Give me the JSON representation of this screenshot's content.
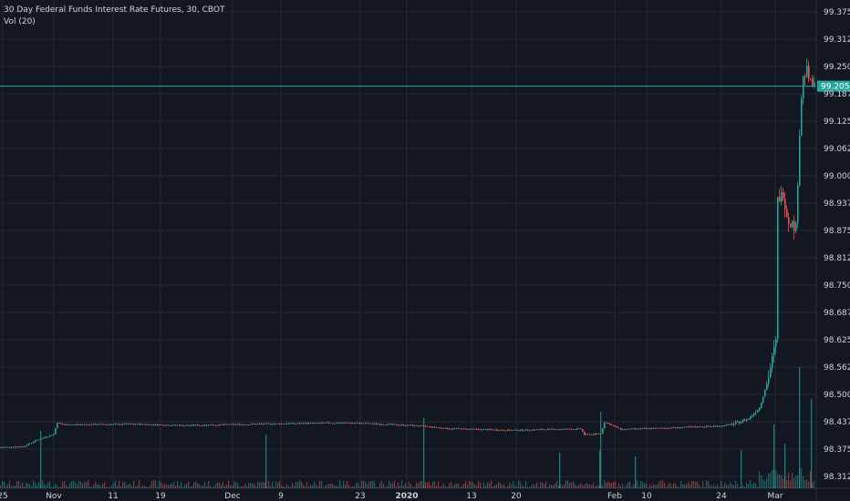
{
  "chart_data": {
    "type": "candlestick",
    "title": "30 Day Federal Funds Interest Rate Futures, 30, CBOT",
    "indicator_label": "Vol (20)",
    "last_price_label": "99.2050",
    "last_price": 99.205,
    "y_ticks": [
      "99.3750",
      "99.3125",
      "99.2500",
      "99.1875",
      "99.1250",
      "99.0625",
      "99.0000",
      "98.9375",
      "98.8750",
      "98.8125",
      "98.7500",
      "98.6875",
      "98.6250",
      "98.5625",
      "98.5000",
      "98.4375",
      "98.3750",
      "98.3125"
    ],
    "ylim": [
      98.3,
      99.39
    ],
    "x_ticks": [
      "25",
      "Nov",
      "11",
      "19",
      "Dec",
      "9",
      "23",
      "2020",
      "13",
      "20",
      "Feb",
      "10",
      "24",
      "Mar"
    ],
    "x_tick_bold": [
      false,
      false,
      false,
      false,
      false,
      false,
      false,
      true,
      false,
      false,
      false,
      false,
      false,
      false
    ],
    "grid": true,
    "colors": {
      "background": "#131722",
      "up": "#26a69a",
      "down": "#ef5350",
      "grid": "#242832",
      "axis_text": "#d1d4dc",
      "price_line": "#26a69a"
    },
    "price_path": [
      {
        "x": 0,
        "y": 98.379
      },
      {
        "x": 25,
        "y": 98.381
      },
      {
        "x": 40,
        "y": 98.396
      },
      {
        "x": 58,
        "y": 98.409
      },
      {
        "x": 62,
        "y": 98.436
      },
      {
        "x": 68,
        "y": 98.431
      },
      {
        "x": 150,
        "y": 98.432
      },
      {
        "x": 200,
        "y": 98.429
      },
      {
        "x": 300,
        "y": 98.433
      },
      {
        "x": 380,
        "y": 98.435
      },
      {
        "x": 420,
        "y": 98.432
      },
      {
        "x": 460,
        "y": 98.428
      },
      {
        "x": 490,
        "y": 98.422
      },
      {
        "x": 560,
        "y": 98.418
      },
      {
        "x": 600,
        "y": 98.42
      },
      {
        "x": 636,
        "y": 98.421
      },
      {
        "x": 640,
        "y": 98.408
      },
      {
        "x": 658,
        "y": 98.41
      },
      {
        "x": 662,
        "y": 98.437
      },
      {
        "x": 680,
        "y": 98.42
      },
      {
        "x": 740,
        "y": 98.424
      },
      {
        "x": 790,
        "y": 98.428
      },
      {
        "x": 805,
        "y": 98.433
      },
      {
        "x": 820,
        "y": 98.445
      },
      {
        "x": 832,
        "y": 98.47
      },
      {
        "x": 840,
        "y": 98.525
      },
      {
        "x": 846,
        "y": 98.58
      },
      {
        "x": 850,
        "y": 98.62
      },
      {
        "x": 852,
        "y": 98.945
      },
      {
        "x": 858,
        "y": 98.96
      },
      {
        "x": 863,
        "y": 98.9
      },
      {
        "x": 868,
        "y": 98.89
      },
      {
        "x": 872,
        "y": 98.88
      },
      {
        "x": 876,
        "y": 99.1
      },
      {
        "x": 879,
        "y": 99.22
      },
      {
        "x": 884,
        "y": 99.24
      },
      {
        "x": 888,
        "y": 99.21
      },
      {
        "x": 892,
        "y": 99.205
      }
    ],
    "volume_spikes": [
      {
        "x": 44,
        "v": 0.45
      },
      {
        "x": 291,
        "v": 0.42
      },
      {
        "x": 464,
        "v": 0.55
      },
      {
        "x": 658,
        "v": 0.6
      },
      {
        "x": 657,
        "v": 0.3
      },
      {
        "x": 613,
        "v": 0.28
      },
      {
        "x": 696,
        "v": 0.25
      },
      {
        "x": 876,
        "v": 0.95
      },
      {
        "x": 889,
        "v": 0.7
      },
      {
        "x": 848,
        "v": 0.5
      },
      {
        "x": 860,
        "v": 0.35
      },
      {
        "x": 812,
        "v": 0.3
      }
    ]
  }
}
